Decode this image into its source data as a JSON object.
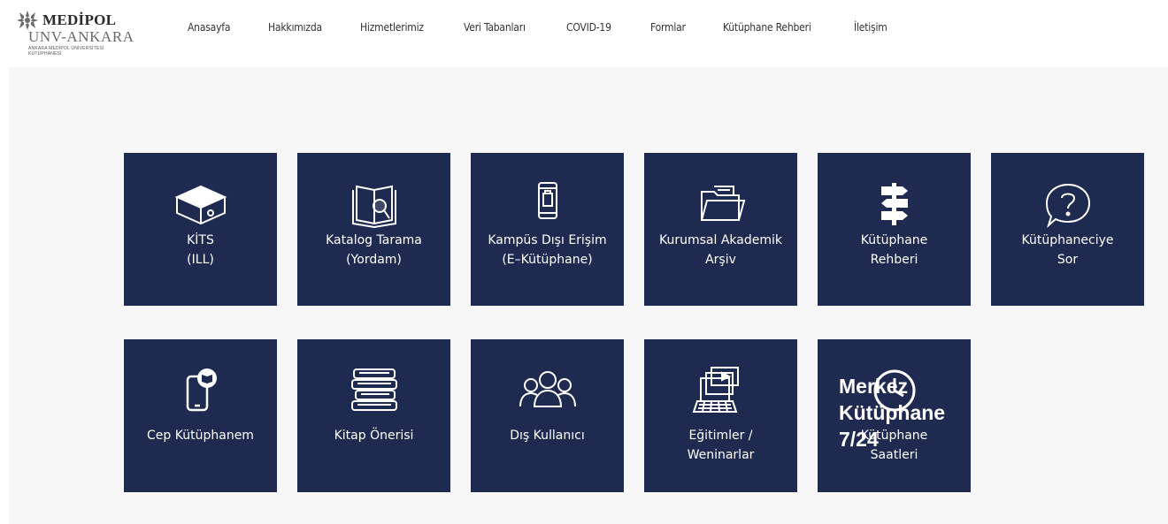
{
  "header": {
    "logo": {
      "name": "MEDİPOL",
      "sub": "UNV-ANKARA",
      "tiny1": "ANKARA MEDİPOL ÜNİVERSİTESİ",
      "tiny2": "KÜTÜPHANESİ"
    },
    "nav": [
      "Anasayfa",
      "Hakkımızda",
      "Hizmetlerimiz",
      "Veri Tabanları",
      "COVID-19",
      "Formlar",
      "Kütüphane Rehberi",
      "İletişim"
    ]
  },
  "tiles": [
    {
      "icon": "package-icon",
      "lines": [
        "KİTS",
        "(ILL)"
      ]
    },
    {
      "icon": "book-search-icon",
      "lines": [
        "Katalog Tarama",
        "(Yordam)"
      ]
    },
    {
      "icon": "mobile-phone-icon",
      "lines": [
        "Kampüs Dışı Erişim",
        "(E–Kütüphane)"
      ]
    },
    {
      "icon": "folder-icon",
      "lines": [
        "Kurumsal Akademik",
        "Arşiv"
      ]
    },
    {
      "icon": "signpost-icon",
      "lines": [
        "Kütüphane",
        "Rehberi"
      ]
    },
    {
      "icon": "question-bubble-icon",
      "lines": [
        "Kütüphaneciye",
        "Sor"
      ]
    },
    {
      "icon": "phone-book-icon",
      "lines": [
        "Cep Kütüphanem"
      ]
    },
    {
      "icon": "book-stack-icon",
      "lines": [
        "Kitap Önerisi"
      ]
    },
    {
      "icon": "users-group-icon",
      "lines": [
        "Dış Kullanıcı"
      ]
    },
    {
      "icon": "computer-video-icon",
      "lines": [
        "Eğitimler /",
        "Weninarlar"
      ]
    },
    {
      "icon": "clock-icon",
      "lines": [
        "Kütüphane",
        "Saatleri"
      ],
      "overlay": [
        "Merkez",
        "Kütüphane",
        "7/24"
      ]
    }
  ]
}
